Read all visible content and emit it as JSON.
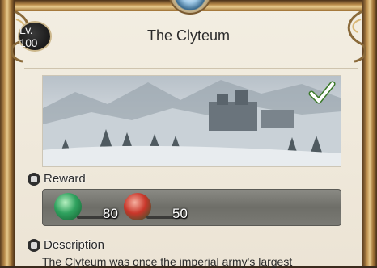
{
  "header": {
    "level": "Lv. 100",
    "title": "The Clyteum"
  },
  "preview": {
    "completed_icon": "checkmark-icon",
    "check_color": "#ffffff"
  },
  "reward": {
    "label": "Reward",
    "items": [
      {
        "icon": "green-tomestone-icon",
        "amount": "80"
      },
      {
        "icon": "red-tomestone-icon",
        "amount": "50"
      }
    ]
  },
  "description": {
    "label": "Description",
    "text": "The Clyteum was once the imperial army's largest"
  }
}
